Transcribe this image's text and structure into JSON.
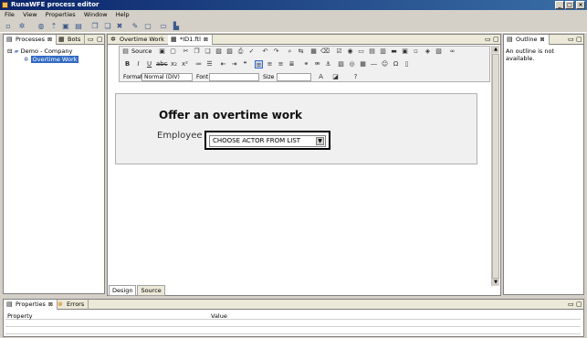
{
  "window": {
    "title": "RunaWFE process editor",
    "buttons": [
      "_",
      "□",
      "×"
    ]
  },
  "menu": [
    "File",
    "View",
    "Properties",
    "Window",
    "Help"
  ],
  "left_panel": {
    "tabs": [
      {
        "label": "Processes",
        "close": "⊠"
      },
      {
        "label": "Bots",
        "close": ""
      }
    ],
    "tree": {
      "root": "Demo - Company",
      "child": "Overtime Work"
    }
  },
  "editor": {
    "tabs": [
      {
        "label": "Overtime Work",
        "close": ""
      },
      {
        "label": "*ID1.ftl",
        "close": "⊠"
      }
    ],
    "toolbar": {
      "source_label": "Source",
      "format_label": "Format",
      "format_value": "Normal (DIV)",
      "font_label": "Font",
      "font_value": "",
      "size_label": "Size",
      "size_value": ""
    },
    "form": {
      "title": "Offer an overtime work",
      "employee_label": "Employee",
      "required_mark": "*",
      "actor_select_value": "CHOOSE ACTOR FROM LIST"
    },
    "bottom_tabs": [
      "Design",
      "Source"
    ]
  },
  "outline": {
    "tab_label": "Outline",
    "close": "⊠",
    "message": "An outline is not available."
  },
  "properties": {
    "tabs": [
      {
        "label": "Properties",
        "close": "⊠"
      },
      {
        "label": "Errors",
        "close": ""
      }
    ],
    "columns": [
      "Property",
      "Value"
    ]
  },
  "colors": {
    "title_bar": "#0a246a",
    "selection": "#316ac5",
    "chrome": "#d4d0c8"
  }
}
